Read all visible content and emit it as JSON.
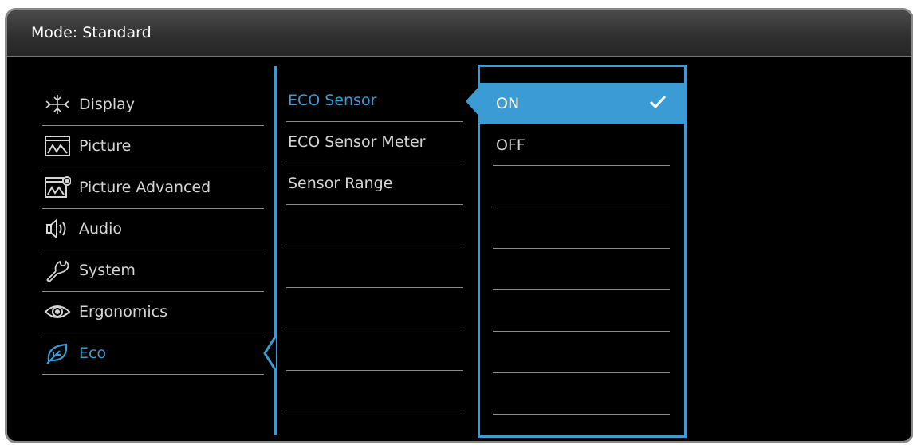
{
  "header": {
    "title": "Mode: Standard"
  },
  "main_menu": {
    "items": [
      {
        "label": "Display",
        "icon": "display-icon"
      },
      {
        "label": "Picture",
        "icon": "picture-icon"
      },
      {
        "label": "Picture Advanced",
        "icon": "picture-advanced-icon"
      },
      {
        "label": "Audio",
        "icon": "audio-icon"
      },
      {
        "label": "System",
        "icon": "system-icon"
      },
      {
        "label": "Ergonomics",
        "icon": "ergonomics-icon"
      },
      {
        "label": "Eco",
        "icon": "eco-icon"
      }
    ],
    "active": "Eco"
  },
  "sub_menu": {
    "items": [
      "ECO Sensor",
      "ECO Sensor Meter",
      "Sensor Range"
    ],
    "active": "ECO Sensor"
  },
  "options": {
    "items": [
      "ON",
      "OFF"
    ],
    "selected": "ON"
  },
  "colors": {
    "accent": "#3a9bd5",
    "background": "#000000",
    "text": "#d6d6d6"
  }
}
